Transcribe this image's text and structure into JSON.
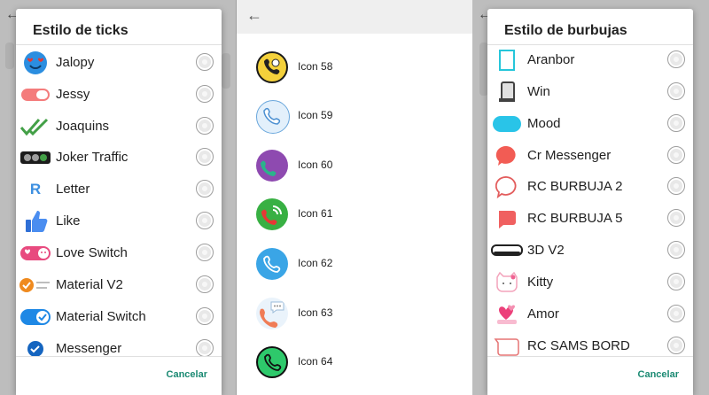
{
  "ticks_dialog": {
    "title": "Estilo de ticks",
    "cancel_label": "Cancelar",
    "items": [
      {
        "label": "Jalopy",
        "icon": "smiley-hearts-icon"
      },
      {
        "label": "Jessy",
        "icon": "toggle-icon"
      },
      {
        "label": "Joaquins",
        "icon": "double-check-icon"
      },
      {
        "label": "Joker Traffic",
        "icon": "traffic-light-icon"
      },
      {
        "label": "Letter",
        "icon": "letter-r-icon"
      },
      {
        "label": "Like",
        "icon": "thumbs-up-icon"
      },
      {
        "label": "Love Switch",
        "icon": "heart-switch-icon"
      },
      {
        "label": "Material V2",
        "icon": "material-check-icon"
      },
      {
        "label": "Material Switch",
        "icon": "check-switch-icon"
      },
      {
        "label": "Messenger",
        "icon": "messenger-check-icon"
      }
    ],
    "letter_glyph": "R"
  },
  "icons_screen": {
    "items": [
      {
        "label": "Icon 58",
        "icon": "phone-emoji-icon"
      },
      {
        "label": "Icon 59",
        "icon": "phone-outline-icon"
      },
      {
        "label": "Icon 60",
        "icon": "phone-purple-icon"
      },
      {
        "label": "Icon 61",
        "icon": "phone-signal-icon"
      },
      {
        "label": "Icon 62",
        "icon": "phone-blue-icon"
      },
      {
        "label": "Icon 63",
        "icon": "phone-chat-icon"
      },
      {
        "label": "Icon 64",
        "icon": "phone-green-icon"
      }
    ]
  },
  "bubbles_dialog": {
    "title": "Estilo de burbujas",
    "cancel_label": "Cancelar",
    "items": [
      {
        "label": "Aranbor",
        "icon": "bubble-aranbor-icon"
      },
      {
        "label": "Win",
        "icon": "bubble-win-icon"
      },
      {
        "label": "Mood",
        "icon": "bubble-mood-icon"
      },
      {
        "label": "Cr Messenger",
        "icon": "bubble-cr-messenger-icon"
      },
      {
        "label": "RC BURBUJA 2",
        "icon": "bubble-rc2-icon"
      },
      {
        "label": "RC BURBUJA 5",
        "icon": "bubble-rc5-icon"
      },
      {
        "label": "3D V2",
        "icon": "bubble-3d-icon"
      },
      {
        "label": "Kitty",
        "icon": "bubble-kitty-icon"
      },
      {
        "label": "Amor",
        "icon": "bubble-amor-icon"
      },
      {
        "label": "RC SAMS BORD",
        "icon": "bubble-sams-bord-icon"
      }
    ]
  },
  "colors": {
    "accent": "#1b8a73",
    "dim_background": "#bdbdbd"
  }
}
